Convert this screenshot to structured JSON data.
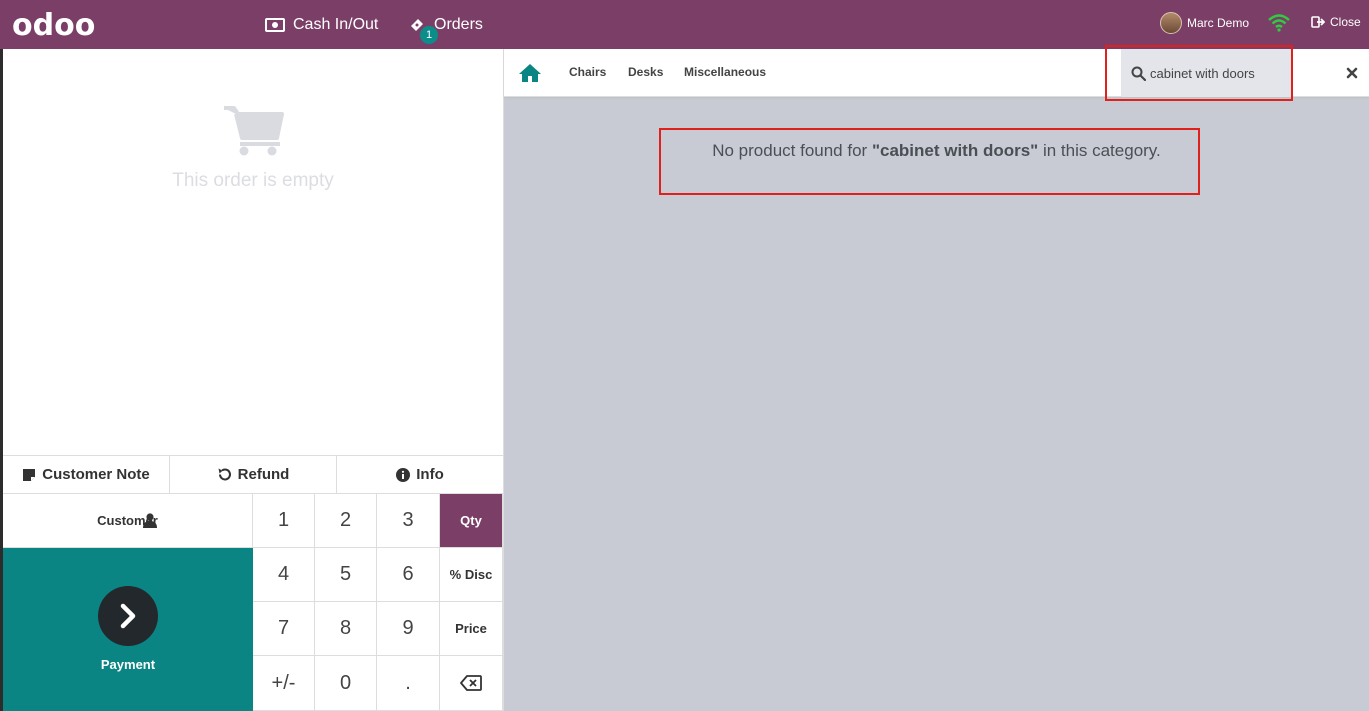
{
  "topbar": {
    "logo": "odoo",
    "cash_label": "Cash In/Out",
    "orders_label": "Orders",
    "orders_badge": "1",
    "user_name": "Marc Demo",
    "close_label": "Close"
  },
  "order": {
    "empty_text": "This order is empty"
  },
  "controls": {
    "customer_note": "Customer Note",
    "refund": "Refund",
    "info": "Info"
  },
  "customer_label": "Customer",
  "payment_label": "Payment",
  "numpad": {
    "keys": [
      "1",
      "2",
      "3",
      "4",
      "5",
      "6",
      "7",
      "8",
      "9",
      "+/-",
      "0",
      "."
    ],
    "qty": "Qty",
    "disc": "% Disc",
    "price": "Price",
    "active_mode": "Qty"
  },
  "categories": [
    "Chairs",
    "Desks",
    "Miscellaneous"
  ],
  "search": {
    "value": "cabinet with doors"
  },
  "message": {
    "prefix": "No product found for ",
    "query": "\"cabinet with doors\"",
    "suffix": " in this category."
  },
  "colors": {
    "brand": "#7b3f67",
    "payment": "#0b8583",
    "highlight": "#e0201b"
  }
}
